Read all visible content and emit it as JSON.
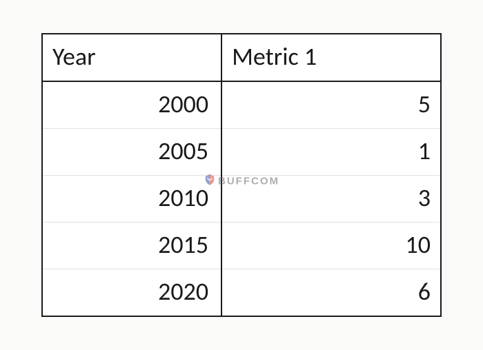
{
  "table": {
    "headers": {
      "year": "Year",
      "metric": "Metric 1"
    },
    "rows": [
      {
        "year": "2000",
        "metric": "5"
      },
      {
        "year": "2005",
        "metric": "1"
      },
      {
        "year": "2010",
        "metric": "3"
      },
      {
        "year": "2015",
        "metric": "10"
      },
      {
        "year": "2020",
        "metric": "6"
      }
    ]
  },
  "watermark": {
    "text": "BUFFCOM"
  },
  "chart_data": {
    "type": "table",
    "title": "",
    "columns": [
      "Year",
      "Metric 1"
    ],
    "categories": [
      2000,
      2005,
      2010,
      2015,
      2020
    ],
    "series": [
      {
        "name": "Metric 1",
        "values": [
          5,
          1,
          3,
          10,
          6
        ]
      }
    ]
  }
}
